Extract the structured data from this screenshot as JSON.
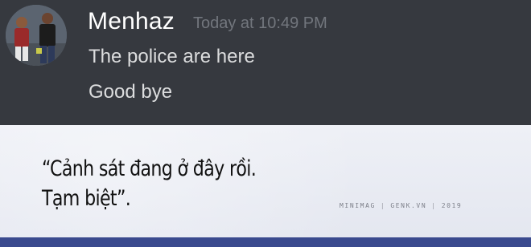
{
  "message": {
    "username": "Menhaz",
    "timestamp": "Today at 10:49 PM",
    "lines": [
      "The police are here",
      "Good bye"
    ],
    "avatar_icon": "user-avatar-photo"
  },
  "caption": {
    "line1": "“Cảnh sát đang ở đây rồi.",
    "line2": "Tạm biệt”."
  },
  "credit": {
    "brand": "MINIMAG",
    "site": "GENK.VN",
    "year": "2019",
    "separator": "|"
  },
  "colors": {
    "chat_background": "#36393f",
    "username": "#ffffff",
    "timestamp": "#72767d",
    "message_text": "#dcddde",
    "caption_background": "#e9ecf3",
    "caption_text": "#111111",
    "accent_bar": "#3a4a8e"
  }
}
